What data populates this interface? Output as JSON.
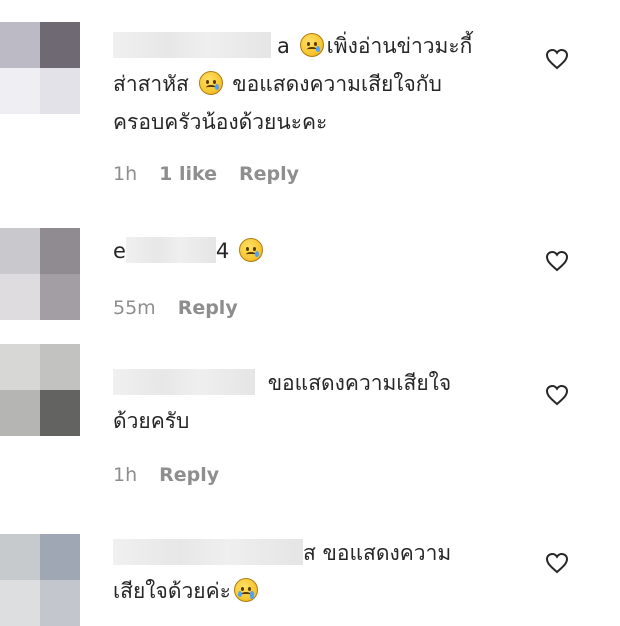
{
  "comments": [
    {
      "text_lines": [
        "เพิ่งอ่านข่าวมะกี้",
        "ส่าสาหัส",
        "ขอแสดงความเสียใจกับ",
        "ครอบครัวน้องด้วยนะคะ"
      ],
      "time": "1h",
      "likes": "1 like",
      "reply": "Reply",
      "name_fragment": "a",
      "icon": "sad-face-emoji"
    },
    {
      "name_fragment_start": "e",
      "name_fragment_end": "4",
      "time": "55m",
      "reply": "Reply",
      "icon": "sad-face-emoji"
    },
    {
      "text_lines": [
        "ขอแสดงความเสียใจ",
        "ด้วยครับ"
      ],
      "time": "1h",
      "reply": "Reply"
    },
    {
      "name_fragment": "ส",
      "text_lines": [
        "ขอแสดงความ",
        "เสียใจด้วยค่ะ"
      ],
      "icon": "crying-face-emoji"
    }
  ],
  "colors": {
    "text": "#262626",
    "meta": "#8e8e8e",
    "heart": "#262626"
  }
}
